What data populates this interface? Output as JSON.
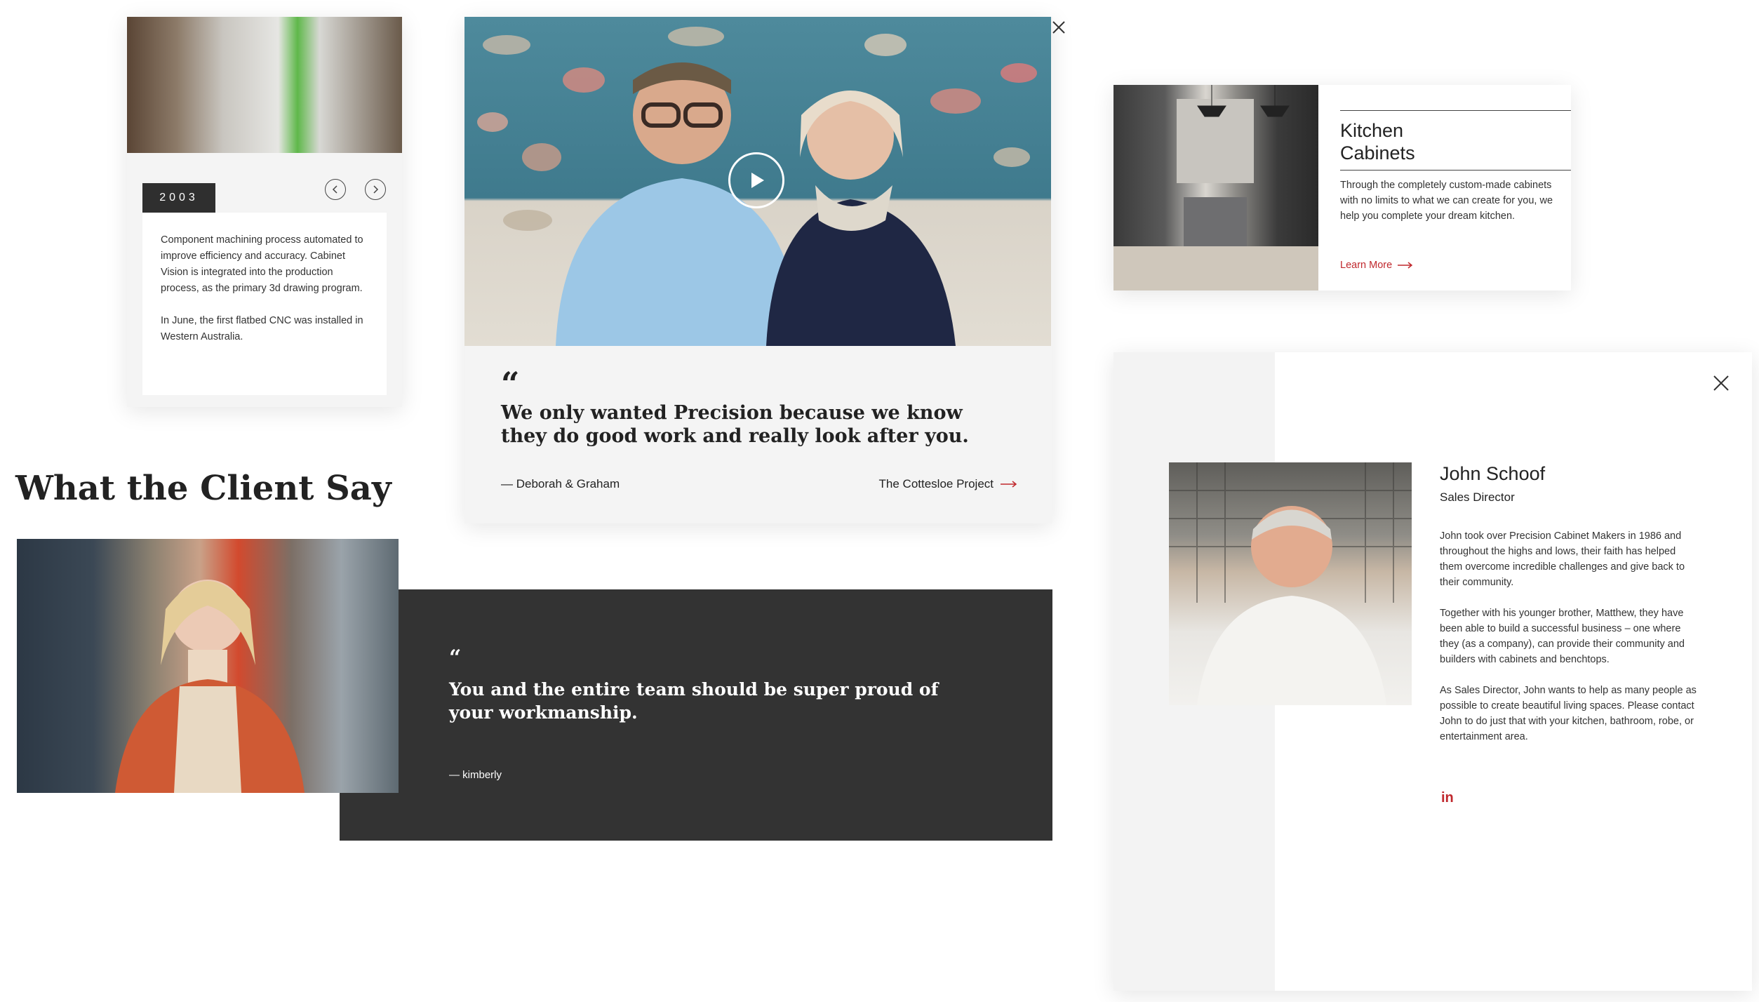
{
  "timeline": {
    "year": "2003",
    "paragraphs": [
      "Component machining process automated to improve efficiency and accuracy. Cabinet Vision is integrated into the production process, as the primary 3d drawing program.",
      "In June, the first flatbed CNC was installed in Western Australia."
    ],
    "prev_icon": "chevron-left-icon",
    "next_icon": "chevron-right-icon"
  },
  "video_testimonial": {
    "quote_mark": "“",
    "quote": "We only wanted Precision because we know they do good work and really look after you.",
    "author": "— Deborah & Graham",
    "project_link": "The Cottesloe Project",
    "play_icon": "play-icon",
    "close_icon": "close-icon"
  },
  "client_section": {
    "heading": "What the Client Say",
    "quote_mark": "“",
    "quote": "You and the entire team should be super proud of your workmanship.",
    "author": "— kimberly"
  },
  "kitchen": {
    "title_line1": "Kitchen",
    "title_line2": "Cabinets",
    "description": "Through the completely custom-made cabinets with no limits to what we can create for you, we help you complete your dream kitchen.",
    "link": "Learn More"
  },
  "profile": {
    "name": "John Schoof",
    "role": "Sales Director",
    "bio": [
      "John took over Precision Cabinet Makers in 1986 and throughout the highs and lows, their faith has helped them overcome incredible challenges and give back to their community.",
      "Together with his younger brother, Matthew, they have been able to build a successful business – one where they (as a company), can provide their community and builders with cabinets and benchtops.",
      "As Sales Director, John wants to help as many people as possible to create beautiful living spaces. Please contact John to do just that with your kitchen, bathroom, robe, or entertainment area."
    ],
    "linkedin": "in",
    "close_icon": "close-icon"
  },
  "colors": {
    "accent_red": "#c0282d",
    "dark_panel": "#333333",
    "light_panel": "#f4f4f4"
  }
}
